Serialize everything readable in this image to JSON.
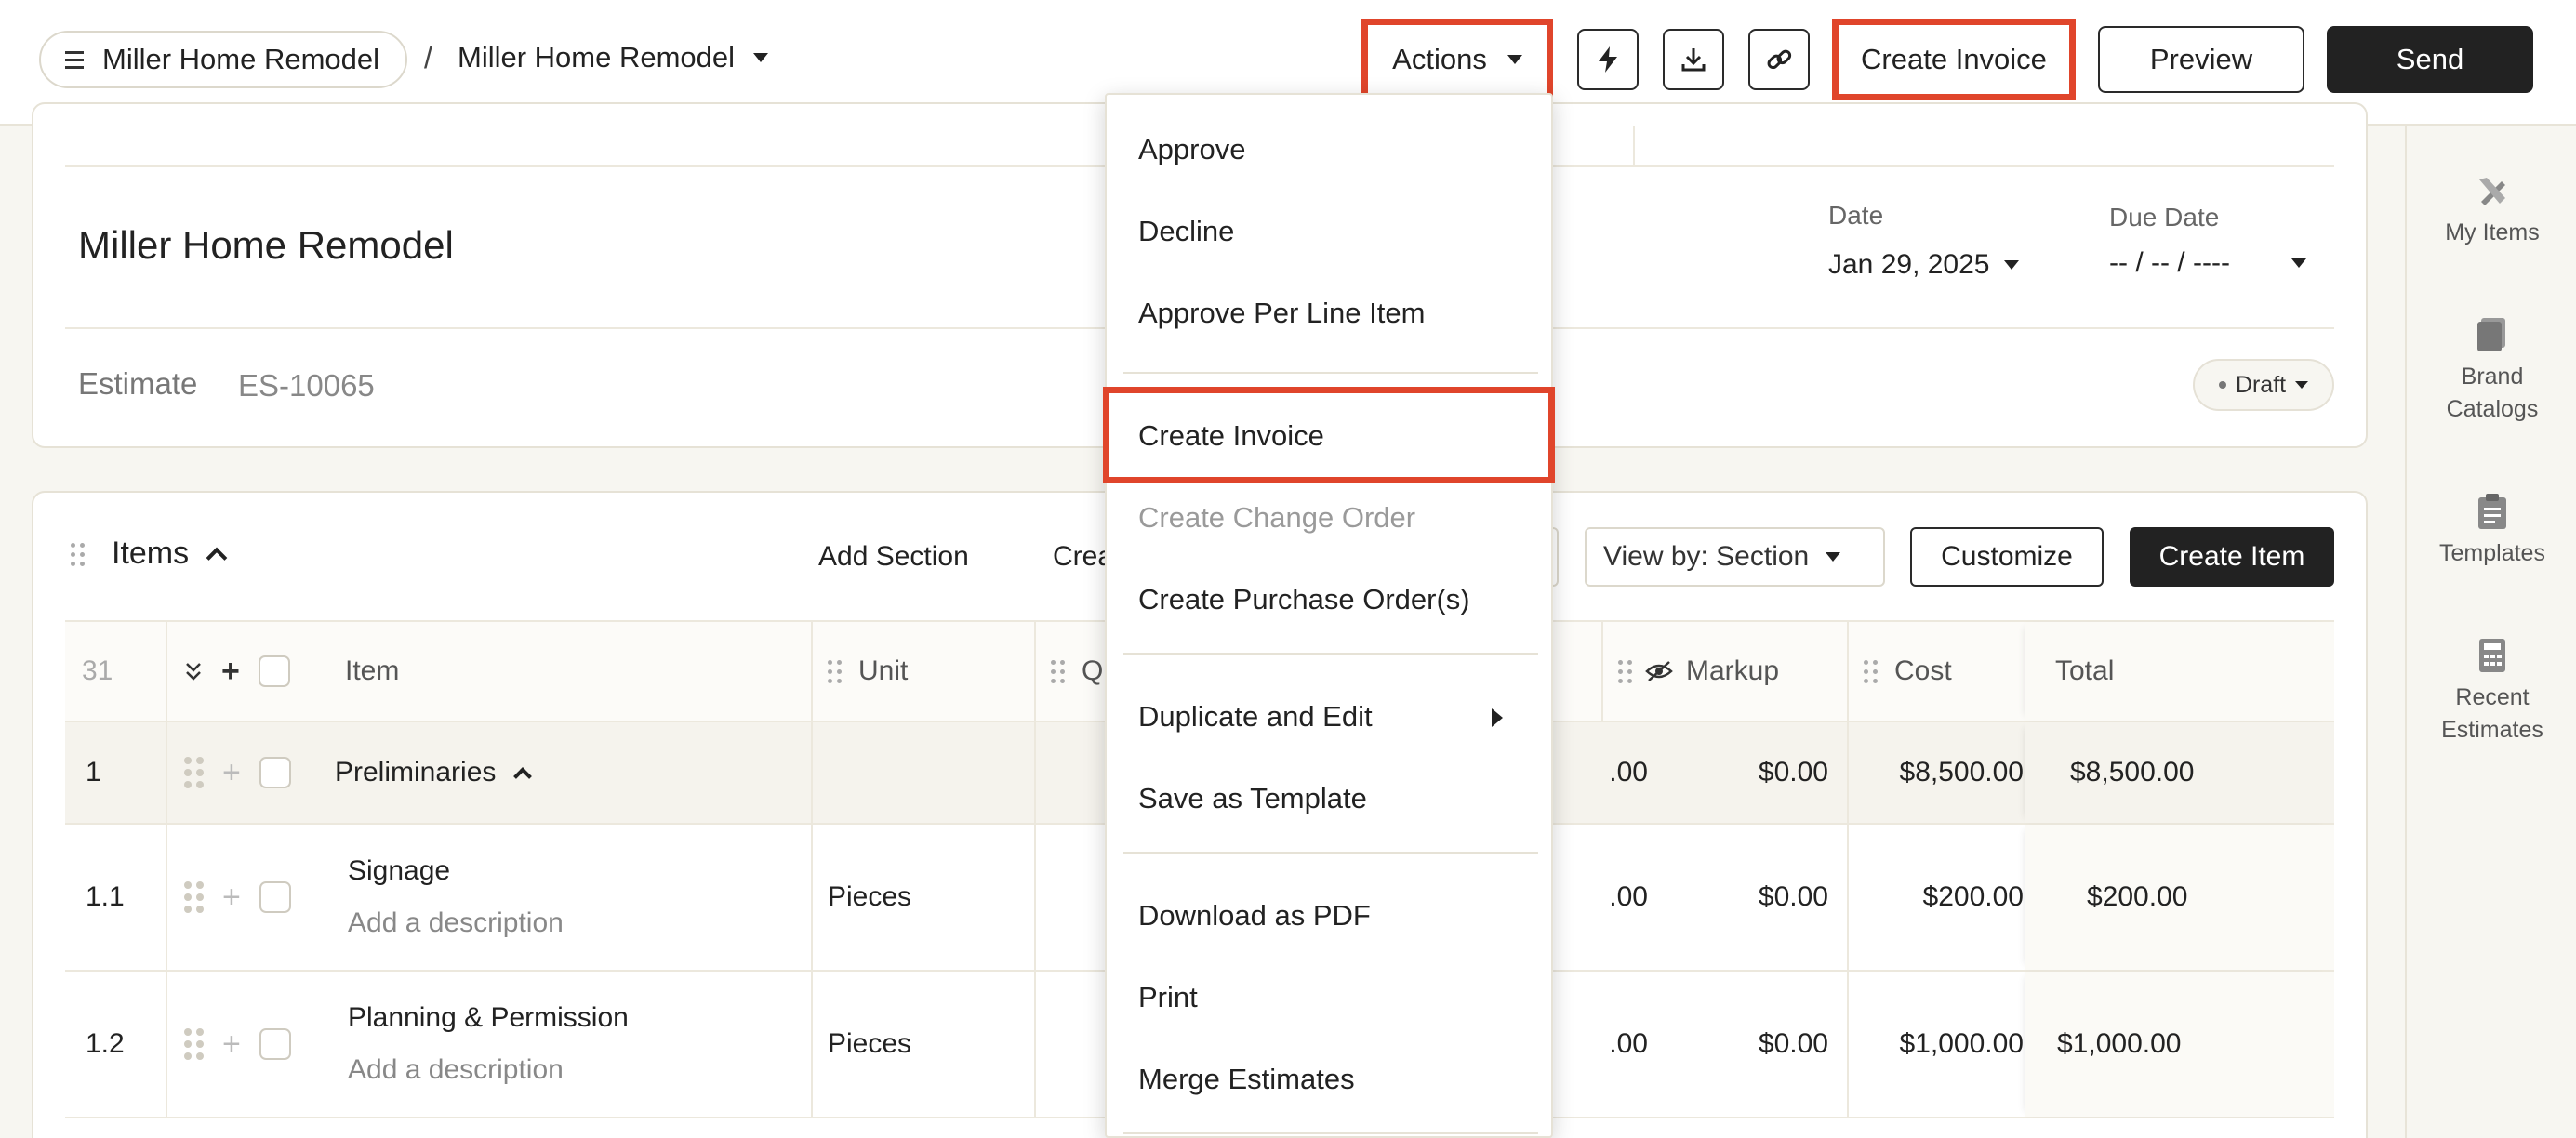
{
  "topbar": {
    "project_menu_label": "Miller Home Remodel",
    "breadcrumb_separator": "/",
    "breadcrumb_current": "Miller Home Remodel",
    "actions_label": "Actions",
    "create_invoice_label": "Create Invoice",
    "preview_label": "Preview",
    "send_label": "Send"
  },
  "estimate": {
    "title": "Miller Home Remodel",
    "date_label": "Date",
    "date_value": "Jan 29, 2025",
    "due_date_label": "Due Date",
    "due_date_value": "-- / -- / ----",
    "estimate_label": "Estimate",
    "estimate_number": "ES-10065",
    "status": "Draft"
  },
  "items_toolbar": {
    "title": "Items",
    "add_section_label": "Add Section",
    "partial_label": "Crea",
    "view_by_label": "View by: Section",
    "customize_label": "Customize",
    "create_item_label": "Create Item"
  },
  "table": {
    "row_count": "31",
    "headers": {
      "item": "Item",
      "unit": "Unit",
      "qty_partial": "Q",
      "markup": "Markup",
      "cost": "Cost",
      "total": "Total"
    },
    "section": {
      "number": "1",
      "name": "Preliminaries",
      "hidden_partial": ".00",
      "markup": "$0.00",
      "cost": "$8,500.00",
      "total": "$8,500.00"
    },
    "rows": [
      {
        "number": "1.1",
        "name": "Signage",
        "description": "Add a description",
        "unit": "Pieces",
        "hidden_partial": ".00",
        "markup": "$0.00",
        "cost": "$200.00",
        "total": "$200.00"
      },
      {
        "number": "1.2",
        "name": "Planning & Permission",
        "description": "Add a description",
        "unit": "Pieces",
        "hidden_partial": ".00",
        "markup": "$0.00",
        "cost": "$1,000.00",
        "total": "$1,000.00"
      }
    ]
  },
  "sidebar": {
    "items": [
      {
        "label_1": "My Items",
        "label_2": "",
        "icon": "pencil-ruler-icon"
      },
      {
        "label_1": "Brand",
        "label_2": "Catalogs",
        "icon": "book-icon"
      },
      {
        "label_1": "Templates",
        "label_2": "",
        "icon": "clipboard-icon"
      },
      {
        "label_1": "Recent",
        "label_2": "Estimates",
        "icon": "calculator-icon"
      }
    ]
  },
  "actions_menu": {
    "items": [
      {
        "label": "Approve"
      },
      {
        "label": "Decline"
      },
      {
        "label": "Approve Per Line Item"
      },
      {
        "label": "Create Invoice"
      },
      {
        "label": "Create Change Order",
        "disabled": true
      },
      {
        "label": "Create Purchase Order(s)"
      },
      {
        "label": "Duplicate and Edit"
      },
      {
        "label": "Save as Template"
      },
      {
        "label": "Download as PDF"
      },
      {
        "label": "Print"
      },
      {
        "label": "Merge Estimates"
      }
    ]
  },
  "colors": {
    "highlight": "#e0452b",
    "primary_dark": "#222222",
    "background": "#f7f6f1"
  }
}
